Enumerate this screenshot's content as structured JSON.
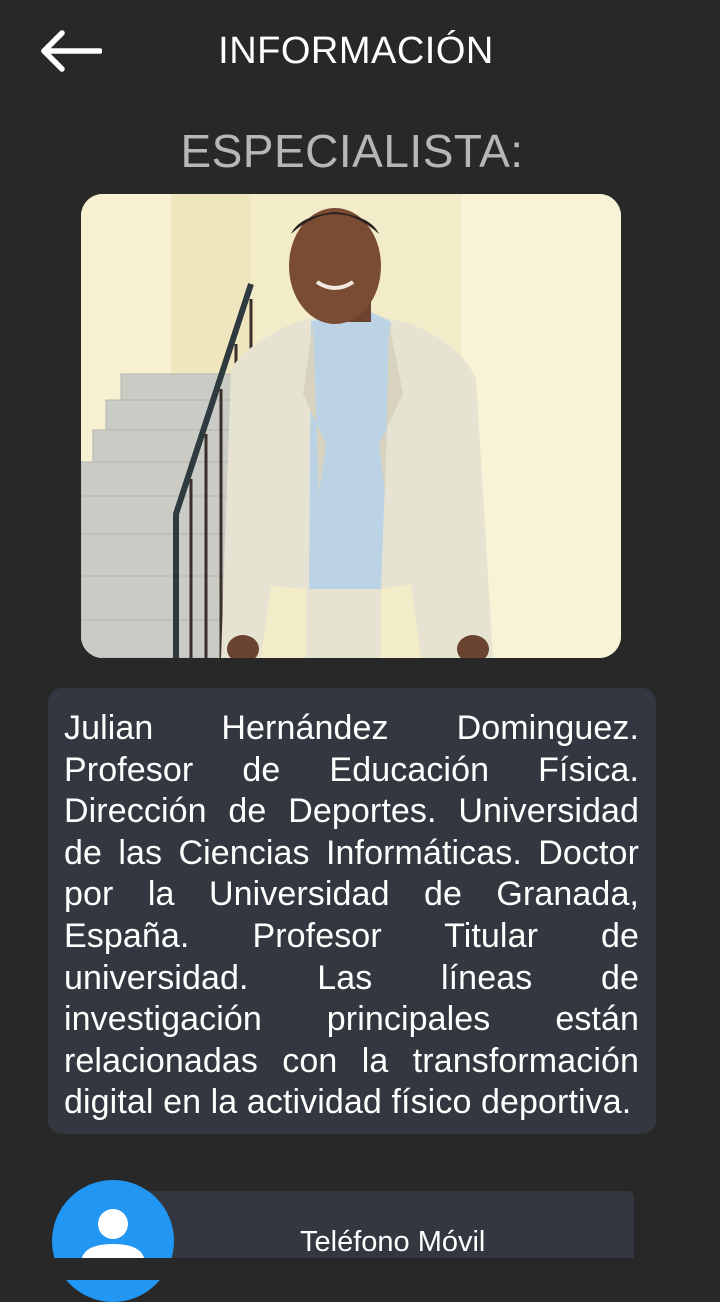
{
  "colors": {
    "background": "#282828",
    "card": "#333840",
    "title_muted": "#b7b7b7",
    "avatar_accent": "#2196f3"
  },
  "header": {
    "back_icon": "arrow-left-icon",
    "title": "INFORMACIÓN"
  },
  "section": {
    "title": "ESPECIALISTA:"
  },
  "specialist": {
    "photo": "specialist-photo",
    "bio": "Julian Hernández Dominguez. Profesor de Educación Física. Dirección de Deportes. Universidad de las Ciencias Informáticas. Doctor por la Universidad de Granada, España. Profesor Titular de universidad. Las líneas de investigación principales están relacionadas con la transformación digital en la actividad físico deportiva."
  },
  "contact": {
    "icon": "person-icon",
    "label": "Teléfono Móvil"
  }
}
